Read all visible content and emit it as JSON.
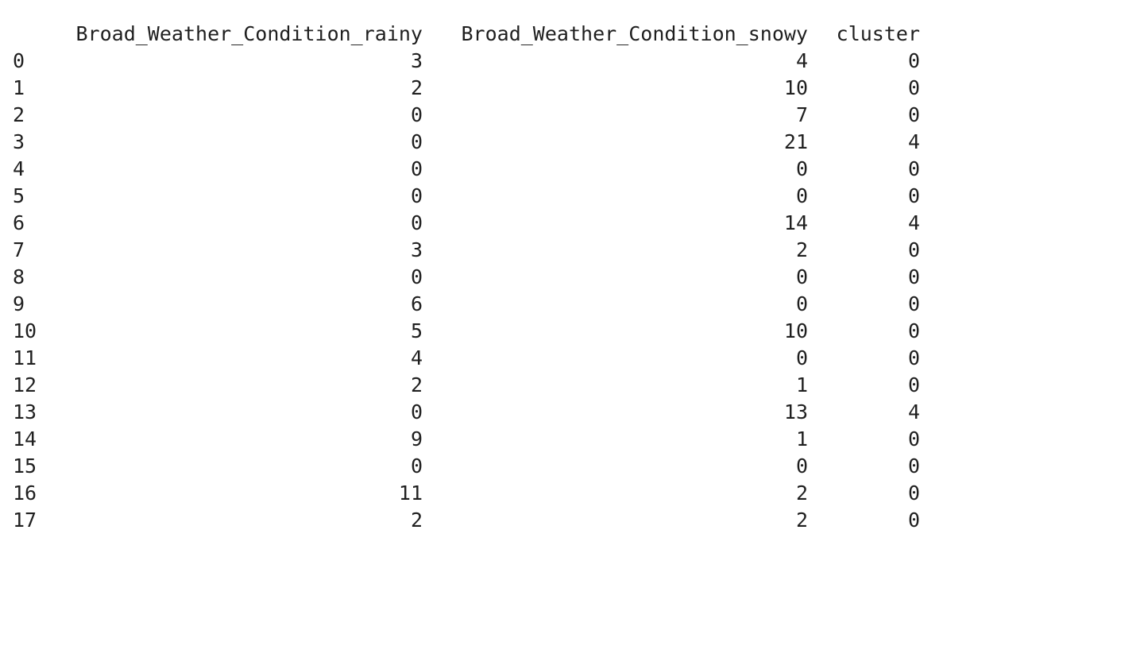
{
  "table": {
    "columns": [
      "Broad_Weather_Condition_rainy",
      "Broad_Weather_Condition_snowy",
      "cluster"
    ],
    "rows": [
      {
        "index": "0",
        "rainy": "3",
        "snowy": "4",
        "cluster": "0"
      },
      {
        "index": "1",
        "rainy": "2",
        "snowy": "10",
        "cluster": "0"
      },
      {
        "index": "2",
        "rainy": "0",
        "snowy": "7",
        "cluster": "0"
      },
      {
        "index": "3",
        "rainy": "0",
        "snowy": "21",
        "cluster": "4"
      },
      {
        "index": "4",
        "rainy": "0",
        "snowy": "0",
        "cluster": "0"
      },
      {
        "index": "5",
        "rainy": "0",
        "snowy": "0",
        "cluster": "0"
      },
      {
        "index": "6",
        "rainy": "0",
        "snowy": "14",
        "cluster": "4"
      },
      {
        "index": "7",
        "rainy": "3",
        "snowy": "2",
        "cluster": "0"
      },
      {
        "index": "8",
        "rainy": "0",
        "snowy": "0",
        "cluster": "0"
      },
      {
        "index": "9",
        "rainy": "6",
        "snowy": "0",
        "cluster": "0"
      },
      {
        "index": "10",
        "rainy": "5",
        "snowy": "10",
        "cluster": "0"
      },
      {
        "index": "11",
        "rainy": "4",
        "snowy": "0",
        "cluster": "0"
      },
      {
        "index": "12",
        "rainy": "2",
        "snowy": "1",
        "cluster": "0"
      },
      {
        "index": "13",
        "rainy": "0",
        "snowy": "13",
        "cluster": "4"
      },
      {
        "index": "14",
        "rainy": "9",
        "snowy": "1",
        "cluster": "0"
      },
      {
        "index": "15",
        "rainy": "0",
        "snowy": "0",
        "cluster": "0"
      },
      {
        "index": "16",
        "rainy": "11",
        "snowy": "2",
        "cluster": "0"
      },
      {
        "index": "17",
        "rainy": "2",
        "snowy": "2",
        "cluster": "0"
      }
    ]
  }
}
